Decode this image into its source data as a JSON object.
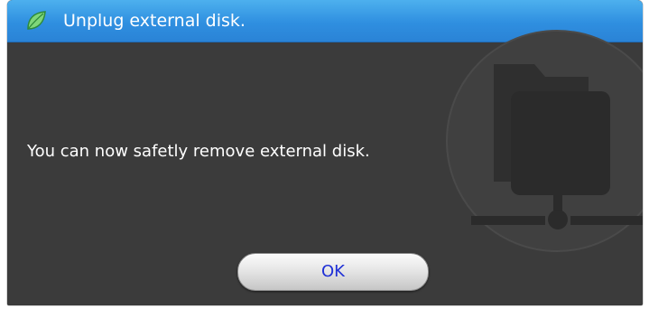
{
  "window": {
    "title": "Unplug external disk.",
    "title_icon": "green-leaf-icon"
  },
  "message": {
    "text": "You can now safetly remove external disk."
  },
  "buttons": {
    "ok_label": "OK"
  },
  "watermark": {
    "icon": "network-folder-icon"
  },
  "colors": {
    "titlebar": "#2f8fe0",
    "background": "#3b3b3b",
    "button_text": "#1e2fd6"
  }
}
